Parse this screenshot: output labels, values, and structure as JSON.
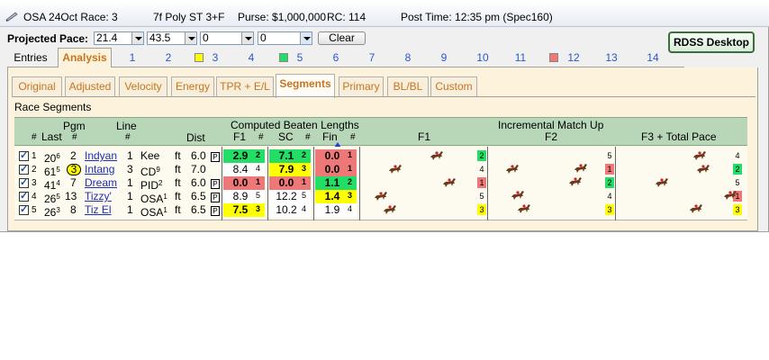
{
  "titlebar": {
    "race": "OSA 24Oct Race: 3",
    "conditions": "7f  Poly  ST  3+F",
    "purse": "Purse: $1,000,000",
    "rc": "RC: 114",
    "post": "Post Time: 12:35 pm  (Spec160)"
  },
  "pace": {
    "label": "Projected Pace:",
    "values": [
      "21.4",
      "43.5",
      "0",
      "0"
    ],
    "clear_label": "Clear"
  },
  "rdss_label": "RDSS Desktop",
  "top_tabs": [
    {
      "label": "Entries"
    },
    {
      "label": "Analysis"
    },
    {
      "label": "1"
    },
    {
      "label": "2"
    },
    {
      "label": "3",
      "swatch": "#ffff00"
    },
    {
      "label": "4"
    },
    {
      "label": "5",
      "swatch": "#22dd66"
    },
    {
      "label": "6"
    },
    {
      "label": "7"
    },
    {
      "label": "8"
    },
    {
      "label": "9"
    },
    {
      "label": "10"
    },
    {
      "label": "11"
    },
    {
      "label": "12",
      "swatch": "#ee7777"
    },
    {
      "label": "13"
    },
    {
      "label": "14"
    }
  ],
  "sub_tabs": [
    "Original",
    "Adjusted",
    "Velocity",
    "Energy",
    "TPR + E/L",
    "Segments",
    "Primary",
    "BL/BL",
    "Custom"
  ],
  "section_title": "Race Segments",
  "headers": {
    "pgm": "Pgm",
    "line": "Line",
    "computed": "Computed Beaten Lengths",
    "incremental": "Incremental Match Up",
    "num": "#",
    "last": "Last",
    "dist": "Dist",
    "f1": "F1",
    "sc": "SC",
    "fin": "Fin",
    "f1_col": "F1",
    "f2_col": "F2",
    "f3_col": "F3 + Total Pace"
  },
  "colors": {
    "green": "#22dd66",
    "yellow": "#ffff00",
    "red": "#ee7777",
    "white": "#ffffff",
    "header_green": "#b8d6b8"
  },
  "rows": [
    {
      "idx": "1",
      "last": "20",
      "last_sup": "6",
      "pgm": "2",
      "name": "Indyan",
      "line": "1",
      "line_sup": "",
      "track": "Kee",
      "ft": "ft",
      "dist": "6.0",
      "p": "P",
      "f1": "2.9",
      "f1_rank": "2",
      "f1_color": "green",
      "sc": "7.1",
      "sc_rank": "2",
      "sc_color": "green",
      "fin": "0.0",
      "fin_rank": "1",
      "fin_color": "red",
      "inc1_rank": "2",
      "inc1_color": "green",
      "inc2_rank": "5",
      "inc2_color": "",
      "inc3_rank": "4",
      "inc3_color": ""
    },
    {
      "idx": "2",
      "last": "61",
      "last_sup": "5",
      "pgm": "3",
      "name": "Intang",
      "line": "3",
      "line_sup": "",
      "track": "CD",
      "track_sup": "9",
      "ft": "ft",
      "dist": "7.0",
      "p": "",
      "f1": "8.4",
      "f1_rank": "4",
      "f1_color": "white",
      "sc": "7.9",
      "sc_rank": "3",
      "sc_color": "yellow",
      "fin": "0.0",
      "fin_rank": "1",
      "fin_color": "red",
      "inc1_rank": "4",
      "inc1_color": "",
      "inc2_rank": "1",
      "inc2_color": "red",
      "inc3_rank": "2",
      "inc3_color": "green"
    },
    {
      "idx": "3",
      "last": "41",
      "last_sup": "4",
      "pgm": "7",
      "name": "Dream",
      "line": "1",
      "line_sup": "",
      "track": "PID",
      "track_sup": "2",
      "ft": "ft",
      "dist": "6.0",
      "p": "P",
      "f1": "0.0",
      "f1_rank": "1",
      "f1_color": "red",
      "sc": "0.0",
      "sc_rank": "1",
      "sc_color": "red",
      "fin": "1.1",
      "fin_rank": "2",
      "fin_color": "green",
      "inc1_rank": "1",
      "inc1_color": "red",
      "inc2_rank": "2",
      "inc2_color": "green",
      "inc3_rank": "5",
      "inc3_color": ""
    },
    {
      "idx": "4",
      "last": "26",
      "last_sup": "5",
      "pgm": "13",
      "name": "Tizzy'",
      "line": "1",
      "line_sup": "",
      "track": "OSA",
      "track_sup": "1",
      "ft": "ft",
      "dist": "6.5",
      "p": "P",
      "f1": "8.9",
      "f1_rank": "5",
      "f1_color": "white",
      "sc": "12.2",
      "sc_rank": "5",
      "sc_color": "white",
      "fin": "1.4",
      "fin_rank": "3",
      "fin_color": "yellow",
      "inc1_rank": "5",
      "inc1_color": "",
      "inc2_rank": "4",
      "inc2_color": "",
      "inc3_rank": "1",
      "inc3_color": "red"
    },
    {
      "idx": "5",
      "last": "26",
      "last_sup": "3",
      "pgm": "8",
      "name": "Tiz El",
      "line": "1",
      "line_sup": "",
      "track": "OSA",
      "track_sup": "1",
      "ft": "ft",
      "dist": "6.5",
      "p": "P",
      "f1": "7.5",
      "f1_rank": "3",
      "f1_color": "yellow",
      "sc": "10.2",
      "sc_rank": "4",
      "sc_color": "white",
      "fin": "1.9",
      "fin_rank": "4",
      "fin_color": "white",
      "inc1_rank": "3",
      "inc1_color": "yellow",
      "inc2_rank": "3",
      "inc2_color": "yellow",
      "inc3_rank": "3",
      "inc3_color": "yellow"
    }
  ]
}
